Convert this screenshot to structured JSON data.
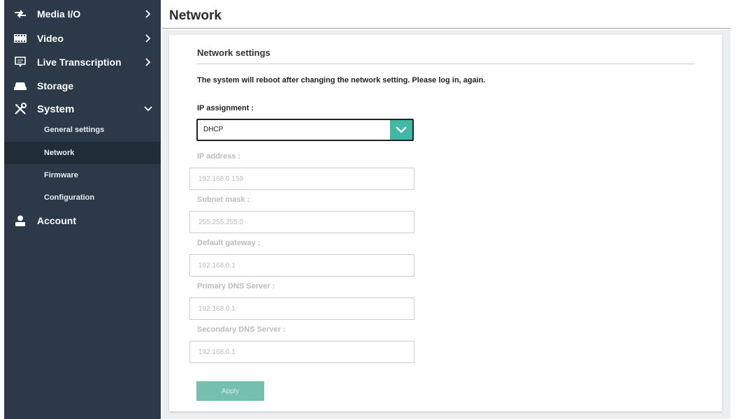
{
  "sidebar": {
    "items": [
      {
        "label": "Media I/O",
        "icon": "transfer-arrows-icon"
      },
      {
        "label": "Video",
        "icon": "film-strip-icon"
      },
      {
        "label": "Live Transcription",
        "icon": "monitor-icon"
      },
      {
        "label": "Storage",
        "icon": "drive-icon"
      },
      {
        "label": "System",
        "icon": "tools-icon"
      },
      {
        "label": "Account",
        "icon": "user-icon"
      }
    ],
    "system_sub": [
      {
        "label": "General settings"
      },
      {
        "label": "Network"
      },
      {
        "label": "Firmware"
      },
      {
        "label": "Configuration"
      }
    ]
  },
  "page": {
    "title": "Network"
  },
  "card": {
    "title": "Network settings",
    "notice": "The system will reboot after changing the network setting. Please log in, again.",
    "ip_assignment_label": "IP assignment :",
    "ip_assignment_value": "DHCP",
    "fields": [
      {
        "label": "IP address :",
        "value": "192.168.0.159"
      },
      {
        "label": "Subnet mask :",
        "value": "255.255.255.0"
      },
      {
        "label": "Default gateway :",
        "value": "192.168.0.1"
      },
      {
        "label": "Primary DNS Server :",
        "value": "192.168.0.1"
      },
      {
        "label": "Secondary DNS Server :",
        "value": "192.168.0.1"
      }
    ],
    "apply_label": "Apply"
  },
  "colors": {
    "sidebar_bg": "#2c3949",
    "sidebar_active": "#212c39",
    "accent": "#3fb8a4",
    "apply_disabled": "#74bfae"
  }
}
